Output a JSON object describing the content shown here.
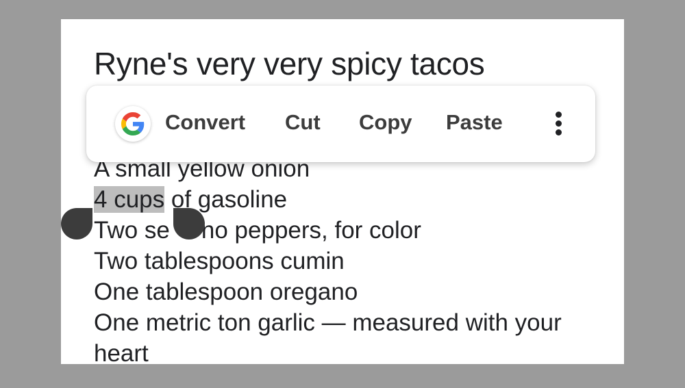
{
  "note": {
    "title": "Ryne's very very spicy tacos",
    "partial_line": "A small yellow onion",
    "selected_text": "4 cups",
    "line2_rest": " of gasoline",
    "line3_start": "Two se",
    "line3_end": "no peppers, for color",
    "line4": "Two tablespoons cumin",
    "line5": "One tablespoon oregano",
    "line6": "One metric ton garlic — measured with your heart"
  },
  "toolbar": {
    "icon": "google-g-icon",
    "convert_label": "Convert",
    "cut_label": "Cut",
    "copy_label": "Copy",
    "paste_label": "Paste",
    "more_icon": "more-vert-icon"
  },
  "colors": {
    "background": "#9b9b9b",
    "screen": "#ffffff",
    "text": "#202124",
    "selection": "#bdbdbd",
    "handle": "#3c3c3c",
    "google_blue": "#4285F4",
    "google_red": "#EA4335",
    "google_yellow": "#FBBC05",
    "google_green": "#34A853"
  }
}
